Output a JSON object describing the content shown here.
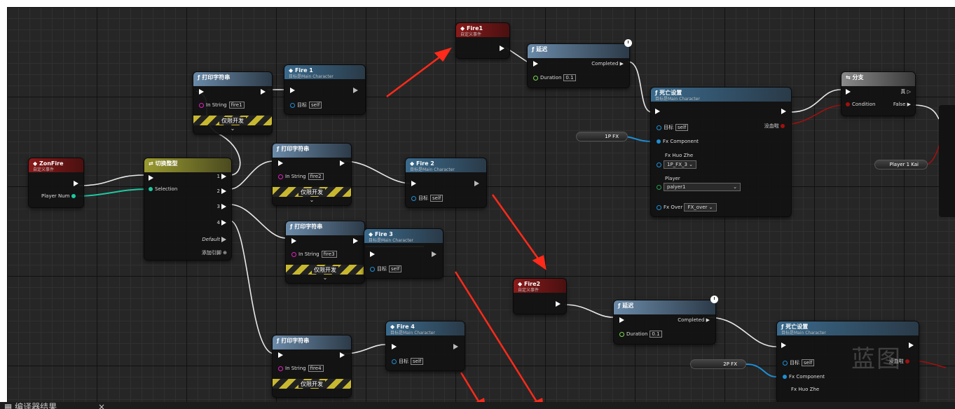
{
  "graph": {
    "zonfire": {
      "title": "ZonFire",
      "subtitle": "自定义事件",
      "pin": "Player Num"
    },
    "switch": {
      "title": "切换整型",
      "selection": "Selection",
      "pins": [
        "1",
        "2",
        "3",
        "4"
      ],
      "default": "Default",
      "add_pin": "添加引脚"
    },
    "print1": {
      "title": "打印字符串",
      "in_string_label": "In String",
      "in_string": "fire1",
      "dev_only": "仅限开发"
    },
    "print2": {
      "title": "打印字符串",
      "in_string_label": "In String",
      "in_string": "fire2",
      "dev_only": "仅限开发"
    },
    "print3": {
      "title": "打印字符串",
      "in_string_label": "In String",
      "in_string": "fire3",
      "dev_only": "仅限开发"
    },
    "print4": {
      "title": "打印字符串",
      "in_string_label": "In String",
      "in_string": "fire4",
      "dev_only": "仅限开发"
    },
    "call1": {
      "title": "Fire 1",
      "subtitle": "目标是Main Character",
      "target_label": "目标",
      "target": "self"
    },
    "call2": {
      "title": "Fire 2",
      "subtitle": "目标是Main Character",
      "target_label": "目标",
      "target": "self"
    },
    "call3": {
      "title": "Fire 3",
      "subtitle": "目标是Main Character",
      "target_label": "目标",
      "target": "self"
    },
    "call4": {
      "title": "Fire 4",
      "subtitle": "目标是Main Character",
      "target_label": "目标",
      "target": "self"
    },
    "event_fire1": {
      "title": "Fire1",
      "subtitle": "自定义事件"
    },
    "event_fire2": {
      "title": "Fire2",
      "subtitle": "自定义事件"
    },
    "delay1": {
      "title": "延迟",
      "completed": "Completed",
      "duration_label": "Duration",
      "duration": "0.1"
    },
    "delay2": {
      "title": "延迟",
      "completed": "Completed",
      "duration_label": "Duration",
      "duration": "0.1"
    },
    "death1": {
      "title": "死亡设置",
      "subtitle": "目标是Main Character",
      "target_label": "目标",
      "target": "self",
      "no_blood": "没血啦",
      "fx_component": "Fx Component",
      "fx_huo_zhe": "Fx Huo Zhe",
      "fx_huo_zhe_val": "1P_FX_3",
      "player_label": "Player",
      "player_val": "palyer1",
      "fx_over": "Fx Over",
      "fx_over_val": "FX_over"
    },
    "death2": {
      "title": "死亡设置",
      "subtitle": "目标是Main Character",
      "target_label": "目标",
      "target": "self",
      "no_blood": "没血啦",
      "fx_component": "Fx Component",
      "fx_huo_zhe": "Fx Huo Zhe"
    },
    "branch": {
      "title": "分支",
      "true": "真",
      "condition": "Condition",
      "false": "False"
    },
    "var_1pfx": "1P FX",
    "var_2pfx": "2P FX",
    "var_player1kai": "Player 1 Kai",
    "watermark": "蓝图"
  },
  "bottom_panel": {
    "tab_label": "编译器结果",
    "close": "×"
  },
  "colors": {
    "event_header": "#8a1a1a",
    "function_header": "#3a6a8c",
    "exec": "#ffffff",
    "int_pin": "#1fc8a0",
    "object_pin": "#1e8fd6",
    "string_pin": "#e020c0",
    "bool_pin": "#a01010",
    "arrow": "#ff2a1a"
  }
}
